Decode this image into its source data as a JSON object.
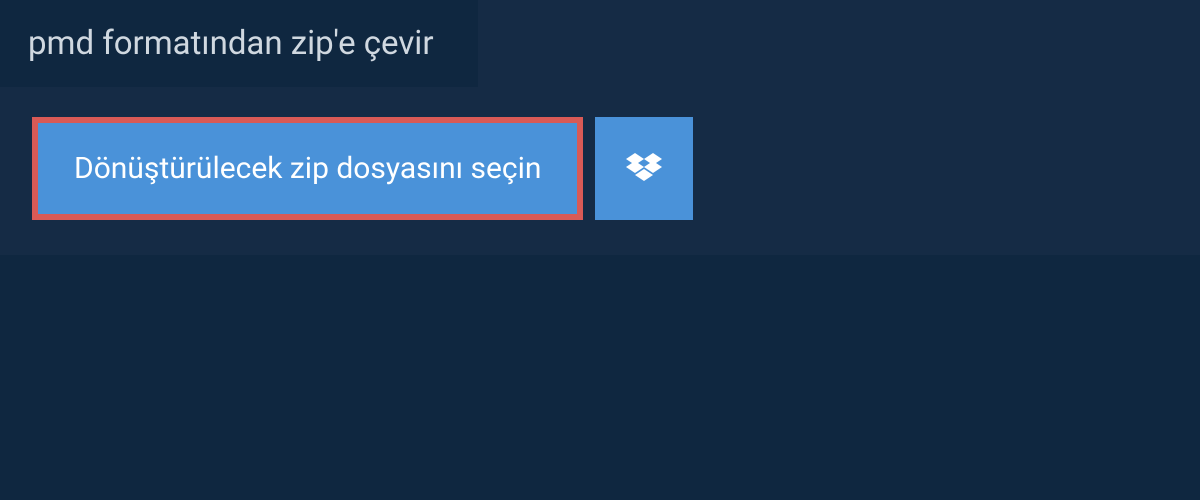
{
  "title": "pmd formatından zip'e çevir",
  "file_select_label": "Dönüştürülecek zip dosyasını seçin",
  "colors": {
    "background_outer": "#0f2740",
    "background_panel": "#152b45",
    "button_primary": "#4a92d9",
    "button_highlight_border": "#d95a56",
    "text_light": "#d0d8e0",
    "text_white": "#ffffff"
  }
}
